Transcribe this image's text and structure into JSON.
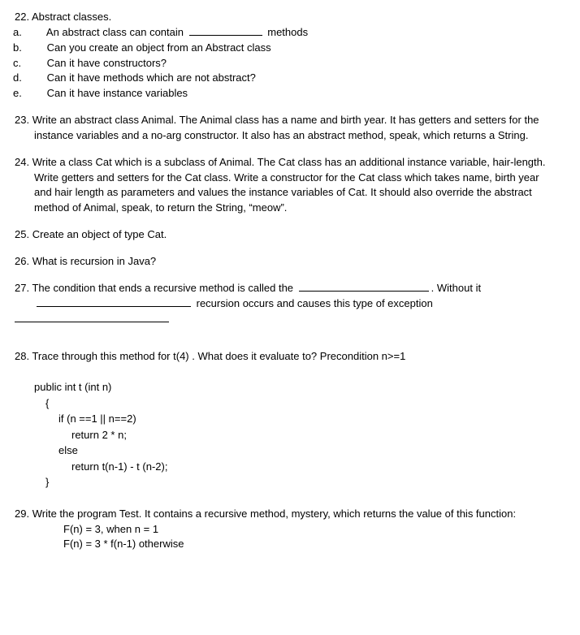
{
  "q22": {
    "num": "22.",
    "title": "Abstract classes.",
    "a_label": "a.",
    "a_pre": "An abstract class can contain",
    "a_post": "methods",
    "b_label": "b.",
    "b": "Can you create an object from an Abstract class",
    "c_label": "c.",
    "c": "Can it have constructors?",
    "d_label": "d.",
    "d": "Can it have methods which are not abstract?",
    "e_label": "e.",
    "e": "Can it have instance variables"
  },
  "q23": {
    "num": "23.",
    "text": "Write an abstract class Animal.  The Animal class has a name and birth year. It has getters and setters for the instance variables and a no-arg constructor. It also has an abstract method, speak, which returns a String."
  },
  "q24": {
    "num": "24.",
    "text": "Write a class Cat which is a subclass of Animal.  The Cat class has an additional instance variable, hair-length. Write getters and setters for the Cat class.  Write a constructor for the Cat class which takes name, birth year and hair length as parameters and values the instance variables of Cat. It should also override the abstract method of Animal, speak, to return the String, “meow”."
  },
  "q25": {
    "num": "25.",
    "text": "Create an object of type Cat."
  },
  "q26": {
    "num": "26.",
    "text": "What is recursion in Java?"
  },
  "q27": {
    "num": "27.",
    "pre": "The condition that ends a recursive method is called the",
    "mid": ".  Without it",
    "post": "recursion occurs and causes this type of exception"
  },
  "q28": {
    "num": "28.",
    "text": "Trace through this method for t(4) .  What does it evaluate to?   Precondition n>=1",
    "code": {
      "l1": "public int t (int n)",
      "l2": "{",
      "l3": "if (n ==1 || n==2)",
      "l4": "return 2 * n;",
      "l5": "else",
      "l6": "return t(n-1) - t (n-2);",
      "l7": "}"
    }
  },
  "q29": {
    "num": "29.",
    "text": "Write the program Test.   It contains a recursive method, mystery, which returns the value of this function:",
    "f1": "F(n) = 3, when n = 1",
    "f2": "F(n) = 3 * f(n-1) otherwise"
  }
}
